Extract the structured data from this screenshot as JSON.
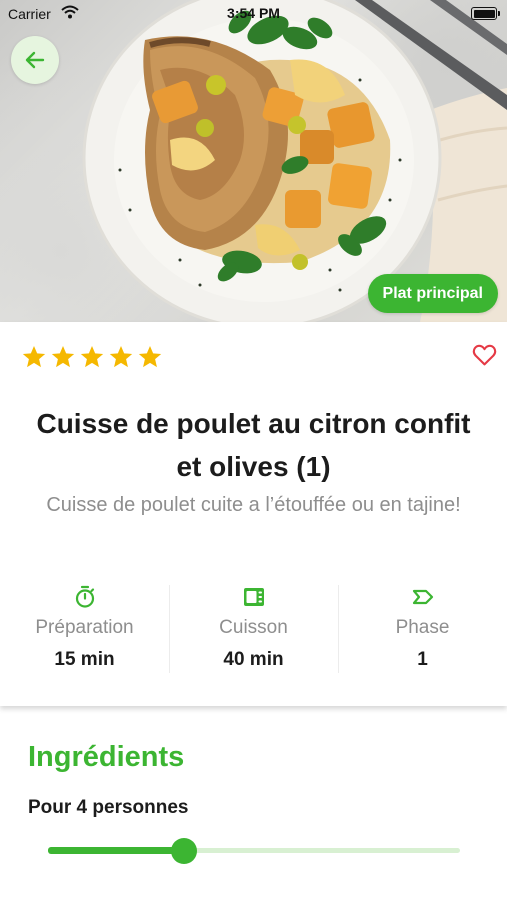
{
  "status_bar": {
    "carrier": "Carrier",
    "time": "3:54 PM"
  },
  "hero": {
    "category_badge": "Plat principal",
    "back_icon": "arrow-left-icon"
  },
  "accent_color": "#3cb532",
  "rating": {
    "value": 5,
    "max": 5,
    "color": "#f5b800"
  },
  "favorite": {
    "icon": "heart-outline-icon",
    "color": "#e53945"
  },
  "recipe": {
    "title": "Cuisse de poulet au citron confit et olives (1)",
    "subtitle": "Cuisse de poulet cuite a l’étouffée ou en tajine!"
  },
  "stats": [
    {
      "icon": "timer-icon",
      "label": "Préparation",
      "value": "15 min"
    },
    {
      "icon": "oven-icon",
      "label": "Cuisson",
      "value": "40 min"
    },
    {
      "icon": "label-tag-icon",
      "label": "Phase",
      "value": "1"
    }
  ],
  "ingredients": {
    "heading": "Ingrédients",
    "servings_label": "Pour 4 personnes",
    "servings_slider": {
      "level": 0.33
    }
  }
}
